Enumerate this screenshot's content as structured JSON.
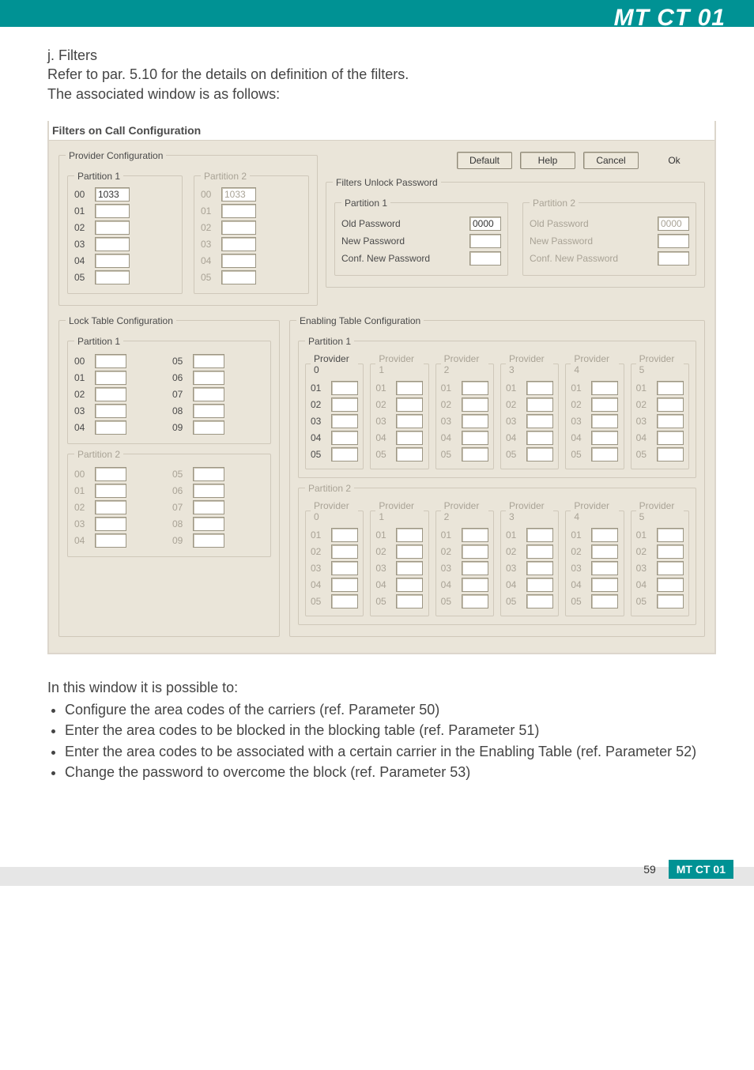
{
  "brand": "MT CT 01",
  "text": {
    "section": "j. Filters",
    "refer": "Refer to par. 5.10 for the details on definition of the filters.",
    "assoc": "The associated window is as follows:",
    "possible_intro": "In this window it is possible to:",
    "bullets": [
      "Configure the area codes of the carriers (ref. Parameter 50)",
      "Enter the area codes to be blocked in the blocking table (ref. Parameter 51)",
      "Enter the area codes to be associated with a certain carrier in the Enabling Table (ref. Parameter 52)",
      "Change the password to overcome the block (ref. Parameter 53)"
    ]
  },
  "window": {
    "title": "Filters on Call Configuration",
    "buttons": {
      "default": "Default",
      "help": "Help",
      "cancel": "Cancel",
      "ok": "Ok"
    },
    "provider_cfg": {
      "legend": "Provider Configuration",
      "p1": {
        "legend": "Partition 1",
        "rows": [
          "00",
          "01",
          "02",
          "03",
          "04",
          "05"
        ],
        "val00": "1033"
      },
      "p2": {
        "legend": "Partition 2",
        "rows": [
          "00",
          "01",
          "02",
          "03",
          "04",
          "05"
        ],
        "val00": "1033"
      }
    },
    "filters_unlock": {
      "legend": "Filters Unlock Password",
      "p1": {
        "legend": "Partition 1",
        "old": "Old Password",
        "new": "New Password",
        "conf": "Conf. New Password",
        "old_val": "0000"
      },
      "p2": {
        "legend": "Partition 2",
        "old": "Old Password",
        "new": "New Password",
        "conf": "Conf. New Password",
        "old_val": "0000"
      }
    },
    "lock": {
      "legend": "Lock Table Configuration",
      "p1": {
        "legend": "Partition 1",
        "left": [
          "00",
          "01",
          "02",
          "03",
          "04"
        ],
        "right": [
          "05",
          "06",
          "07",
          "08",
          "09"
        ]
      },
      "p2": {
        "legend": "Partition 2",
        "left": [
          "00",
          "01",
          "02",
          "03",
          "04"
        ],
        "right": [
          "05",
          "06",
          "07",
          "08",
          "09"
        ]
      }
    },
    "enable": {
      "legend": "Enabling Table Configuration",
      "p1": {
        "legend": "Partition 1"
      },
      "p2": {
        "legend": "Partition 2"
      },
      "providers": [
        "Provider 0",
        "Provider 1",
        "Provider 2",
        "Provider 3",
        "Provider 4",
        "Provider 5"
      ],
      "rows": [
        "01",
        "02",
        "03",
        "04",
        "05"
      ]
    }
  },
  "footer": {
    "page": "59",
    "brand": "MT CT 01"
  }
}
